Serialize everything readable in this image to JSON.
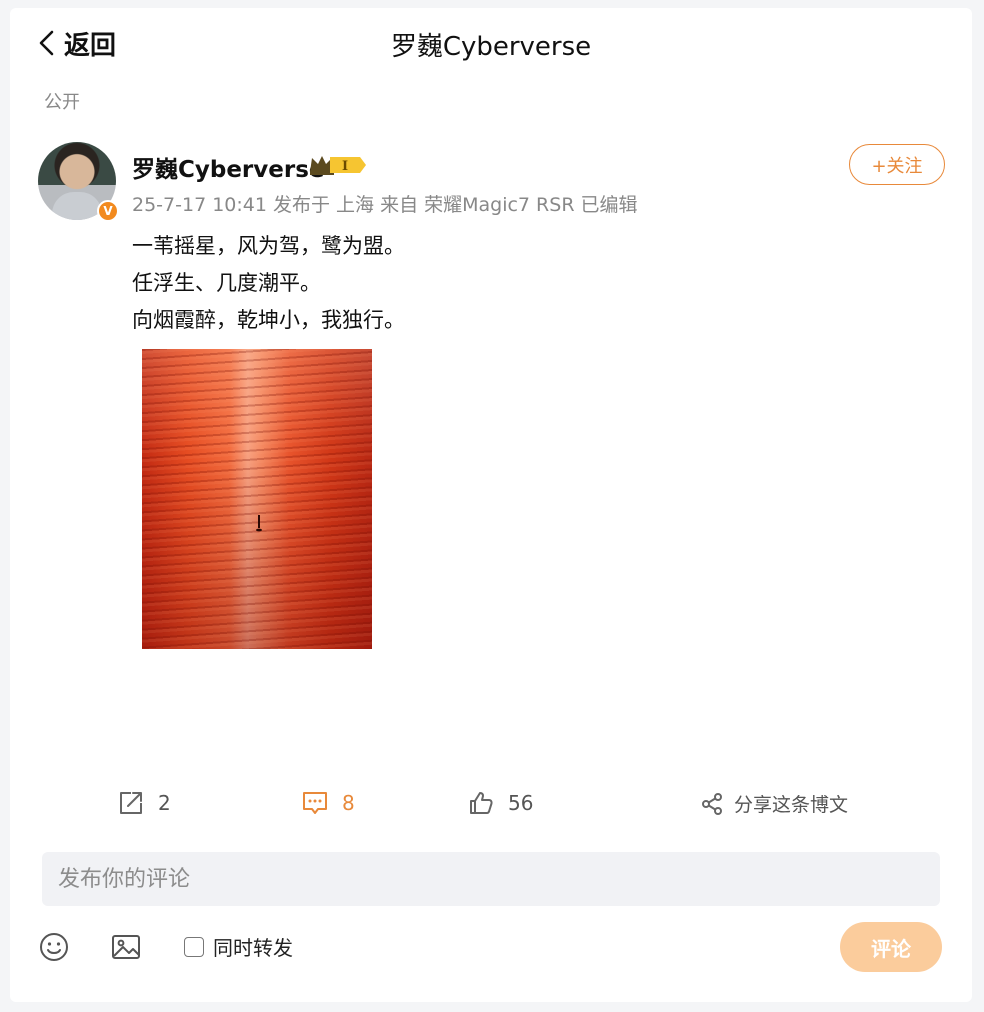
{
  "header": {
    "back_label": "返回",
    "title": "罗巍Cyberverse"
  },
  "post": {
    "visibility": "公开",
    "author": "罗巍Cyberverse",
    "verified_badge": "V",
    "rank_badge": "I",
    "meta": "25-7-17 10:41 发布于 上海 来自 荣耀Magic7 RSR 已编辑",
    "follow_label": "+关注",
    "content_lines": [
      "一苇摇星，风为驾，鹭为盟。",
      "任浮生、几度潮平。",
      "向烟霞醉，乾坤小，我独行。"
    ],
    "image": "red-sunset-sea-with-paddleboarder"
  },
  "actions": {
    "repost_count": "2",
    "comment_count": "8",
    "like_count": "56",
    "share_label": "分享这条博文"
  },
  "composer": {
    "placeholder": "发布你的评论",
    "emoji": "emoji-icon",
    "image": "image-icon",
    "repost_label": "同时转发",
    "submit_label": "评论"
  },
  "colors": {
    "accent": "#e8893a",
    "submit_disabled": "#fbcc9c",
    "muted_text": "#888888",
    "input_bg": "#f1f2f5"
  }
}
